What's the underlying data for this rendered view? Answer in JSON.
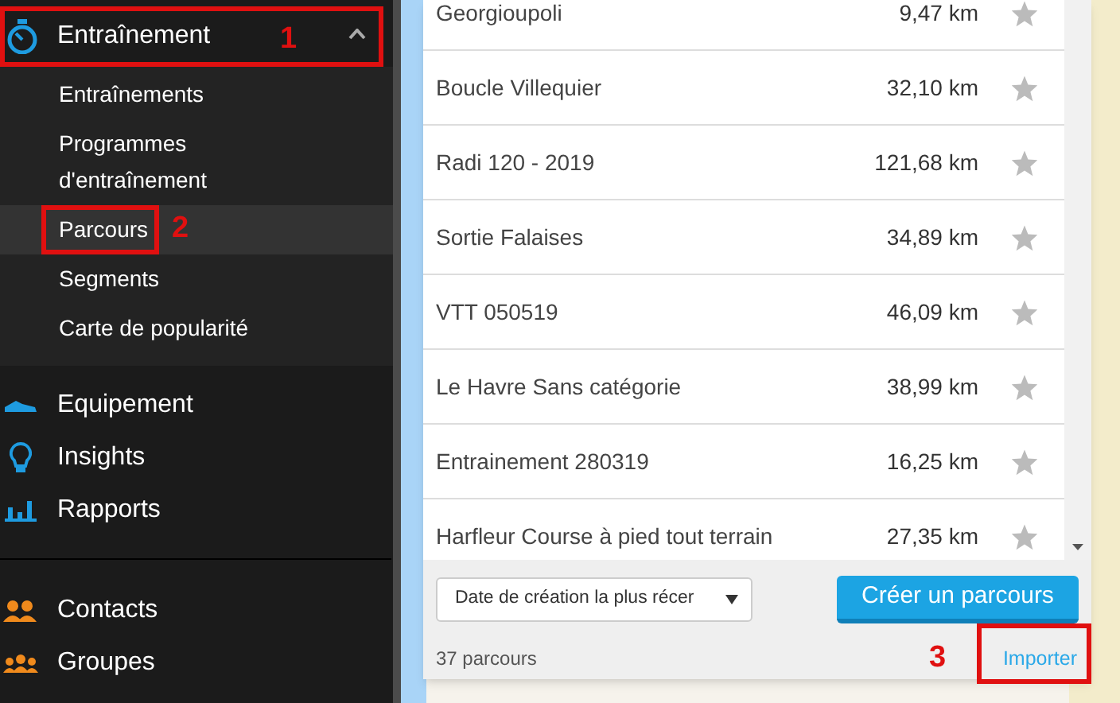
{
  "sidebar": {
    "section": {
      "label": "Entraînement",
      "expanded": true,
      "annotation": "1",
      "children": [
        {
          "label": "Entraînements",
          "selected": false
        },
        {
          "label": "Programmes d'entraînement",
          "selected": false
        },
        {
          "label": "Parcours",
          "selected": true,
          "annotation": "2"
        },
        {
          "label": "Segments",
          "selected": false
        },
        {
          "label": "Carte de popularité",
          "selected": false
        }
      ]
    },
    "items": [
      {
        "label": "Equipement",
        "kind": "shoe"
      },
      {
        "label": "Insights",
        "kind": "bulb"
      },
      {
        "label": "Rapports",
        "kind": "chart"
      }
    ],
    "social_items": [
      {
        "label": "Contacts",
        "kind": "people"
      },
      {
        "label": "Groupes",
        "kind": "group"
      }
    ]
  },
  "routes": [
    {
      "name": "Georgioupoli",
      "distance": "9,47 km",
      "favorite": false
    },
    {
      "name": "Boucle Villequier",
      "distance": "32,10 km",
      "favorite": false
    },
    {
      "name": "Radi 120 - 2019",
      "distance": "121,68 km",
      "favorite": false
    },
    {
      "name": "Sortie Falaises",
      "distance": "34,89 km",
      "favorite": false
    },
    {
      "name": "VTT 050519",
      "distance": "46,09 km",
      "favorite": false
    },
    {
      "name": "Le Havre Sans catégorie",
      "distance": "38,99 km",
      "favorite": false
    },
    {
      "name": "Entrainement 280319",
      "distance": "16,25 km",
      "favorite": false
    },
    {
      "name": "Harfleur Course à pied tout terrain",
      "distance": "27,35 km",
      "favorite": false
    }
  ],
  "sort_select": {
    "value": "Date de création la plus récer"
  },
  "create_button": "Créer un parcours",
  "count": "37 parcours",
  "import_link": {
    "label": "Importer",
    "annotation": "3"
  }
}
